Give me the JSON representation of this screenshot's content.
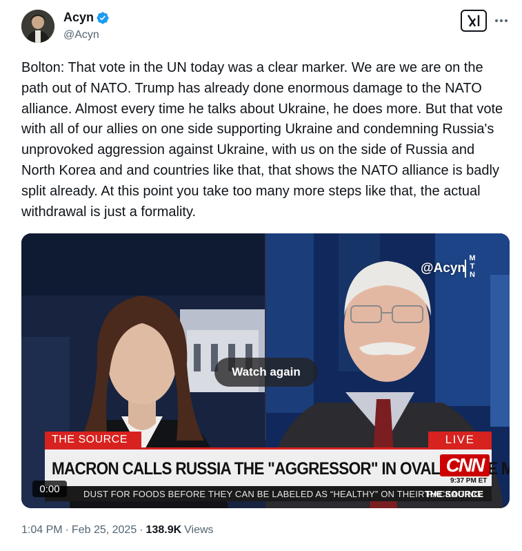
{
  "author": {
    "display_name": "Acyn",
    "handle": "@Acyn",
    "avatar_icon": "profile-photo",
    "verified_color": "#1d9bf0"
  },
  "actions": {
    "grok_icon": "grok-icon",
    "more_icon": "more-dots-icon"
  },
  "tweet": {
    "text": "Bolton: That vote in the UN today was a clear marker. We are we are on the path out of NATO. Trump has already done enormous damage to the NATO alliance. Almost every time he talks about Ukraine, he does more. But that vote with all of our allies on one side supporting Ukraine and condemning Russia's unprovoked aggression against Ukraine, with us on the side of Russia and North Korea and and countries like that, that shows the NATO alliance is badly split already. At this point you take too many more steps like that, the actual withdrawal is just a formality."
  },
  "video": {
    "watermark": "@Acyn",
    "watermark_logo": [
      "M",
      "T",
      "N"
    ],
    "watch_again_label": "Watch again",
    "show_tag": "THE SOURCE",
    "live_tag": "LIVE",
    "headline": "MACRON CALLS RUSSIA THE \"AGGRESSOR\" IN OVAL OFFICE MEETING",
    "network_logo": "CNN",
    "time_et": "9:37 PM ET",
    "ticker_text": "DUST FOR FOODS BEFORE THEY CAN BE LABELED AS “HEALTHY” ON THEIR PACKAGING",
    "ticker_brand": "THE SOURCE",
    "timestamp": "0:00",
    "accent_color": "#d7221f"
  },
  "meta": {
    "time": "1:04 PM",
    "separator": "·",
    "date": "Feb 25, 2025",
    "views_count": "138.9K",
    "views_label": "Views"
  }
}
